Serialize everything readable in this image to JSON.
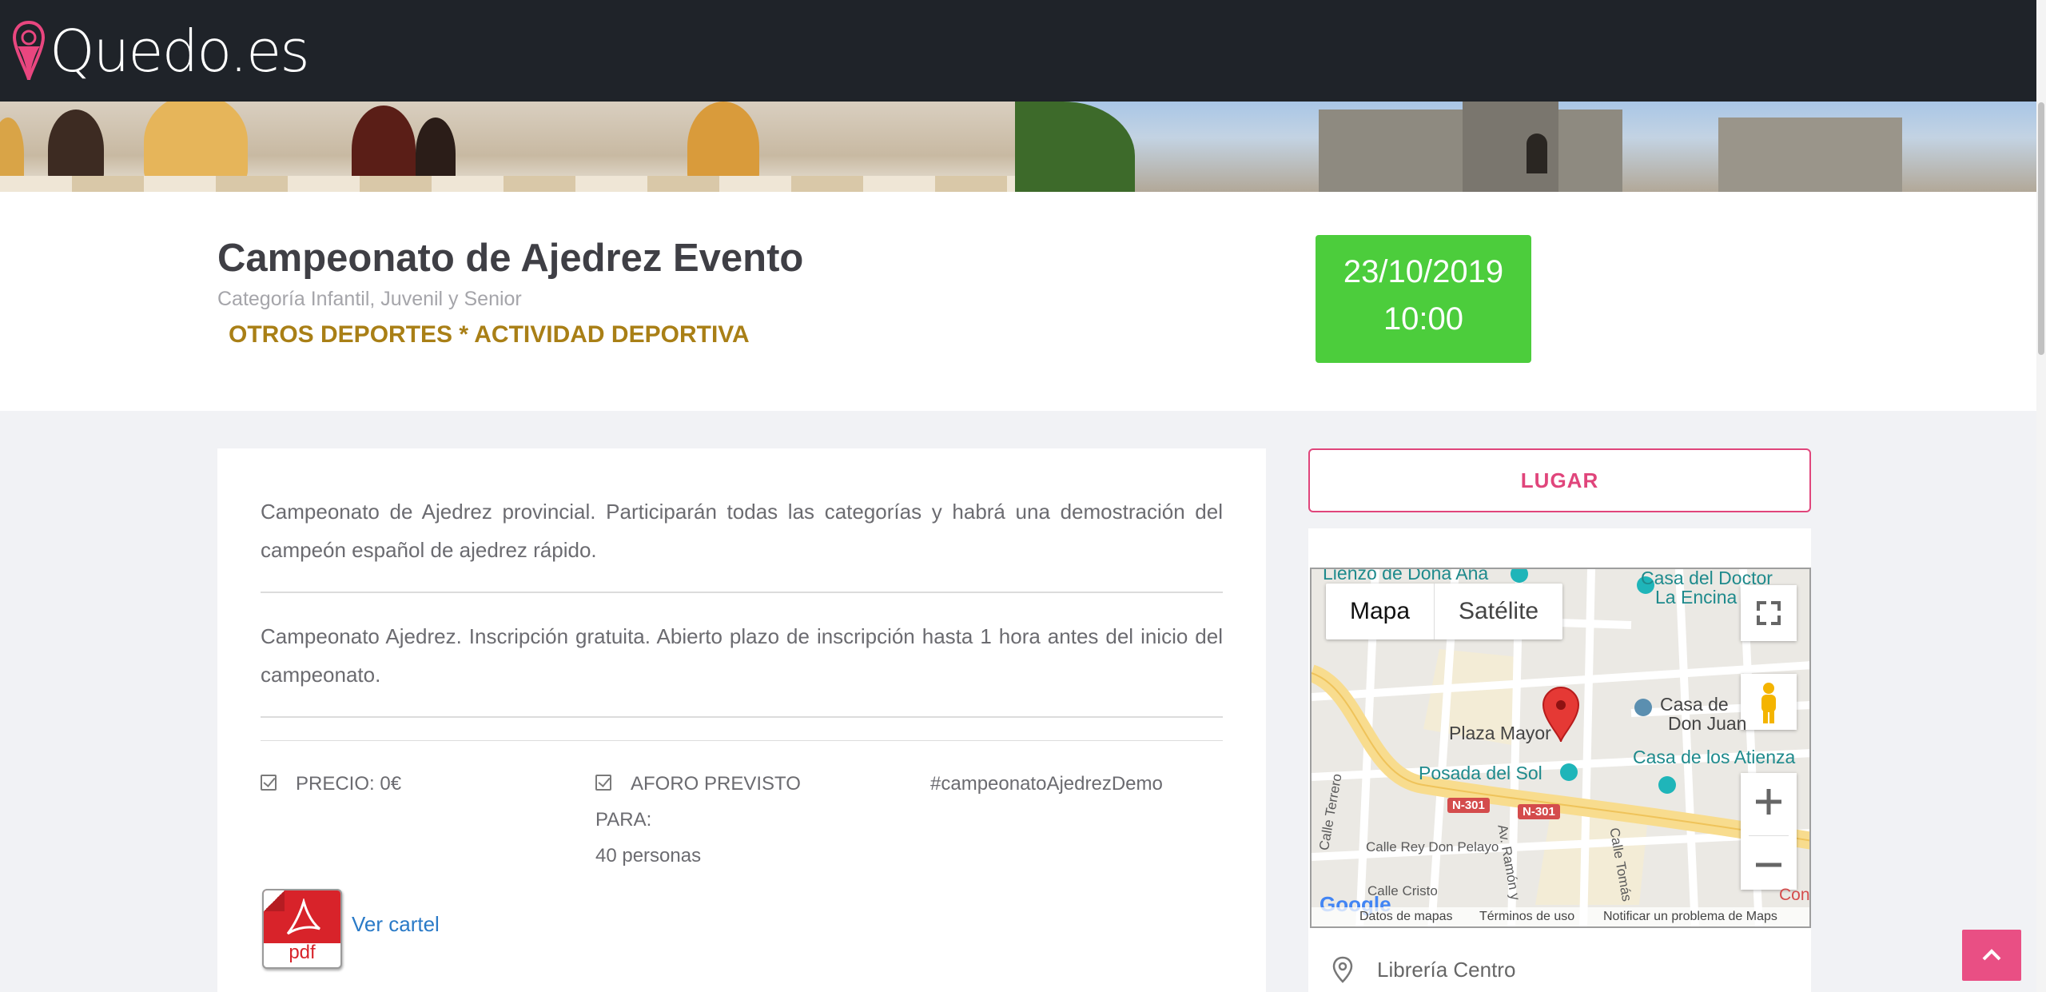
{
  "header": {
    "logo_text": "Quedo.es"
  },
  "event": {
    "title": "Campeonato de Ajedrez Evento",
    "subtitle": "Categoría Infantil, Juvenil y Senior",
    "category": "OTROS DEPORTES * ACTIVIDAD DEPORTIVA",
    "date": "23/10/2019",
    "time": "10:00"
  },
  "description": {
    "paragraph1": "Campeonato de Ajedrez provincial. Participarán todas las categorías y habrá una demostración del campeón español de ajedrez rápido.",
    "paragraph2": "Campeonato Ajedrez. Inscripción gratuita. Abierto plazo de inscripción hasta 1 hora antes del inicio del campeonato."
  },
  "features": {
    "price": "PRECIO: 0€",
    "capacity_label": "AFORO PREVISTO",
    "capacity_for": "PARA:",
    "capacity_value": "40 personas",
    "hashtag": "#campeonatoAjedrezDemo"
  },
  "poster": {
    "icon_label": "pdf",
    "link_text": "Ver cartel"
  },
  "sidebar": {
    "lugar_button": "LUGAR",
    "venue_name": "Librería Centro"
  },
  "map": {
    "type_map": "Mapa",
    "type_satellite": "Satélite",
    "labels": {
      "lienzo": "Lienzo de Doña Ana",
      "casa_doctor_1": "Casa del Doctor",
      "casa_doctor_2": "La Encina",
      "plaza_mayor": "Plaza Mayor",
      "casa_de_1": "Casa de",
      "casa_de_2": "Don Juan",
      "atienza": "Casa de los Atienza",
      "posada": "Posada del Sol",
      "road1": "N-301",
      "road2": "N-301",
      "calle_terrero": "Calle Terrero",
      "calle_rey": "Calle Rey Don Pelayo",
      "av_ramon": "Av. Ramón y",
      "calle_tomas": "Calle Tomás",
      "calle_cristo": "Calle Cristo",
      "confi": "Confi",
      "google": "Google"
    },
    "footer_data": "Datos de mapas",
    "footer_terms": "Términos de uso",
    "footer_report": "Notificar un problema de Maps"
  },
  "colors": {
    "header_bg": "#1f2329",
    "date_bg": "#4ccd3c",
    "category": "#a97f16",
    "accent": "#e0457b"
  }
}
